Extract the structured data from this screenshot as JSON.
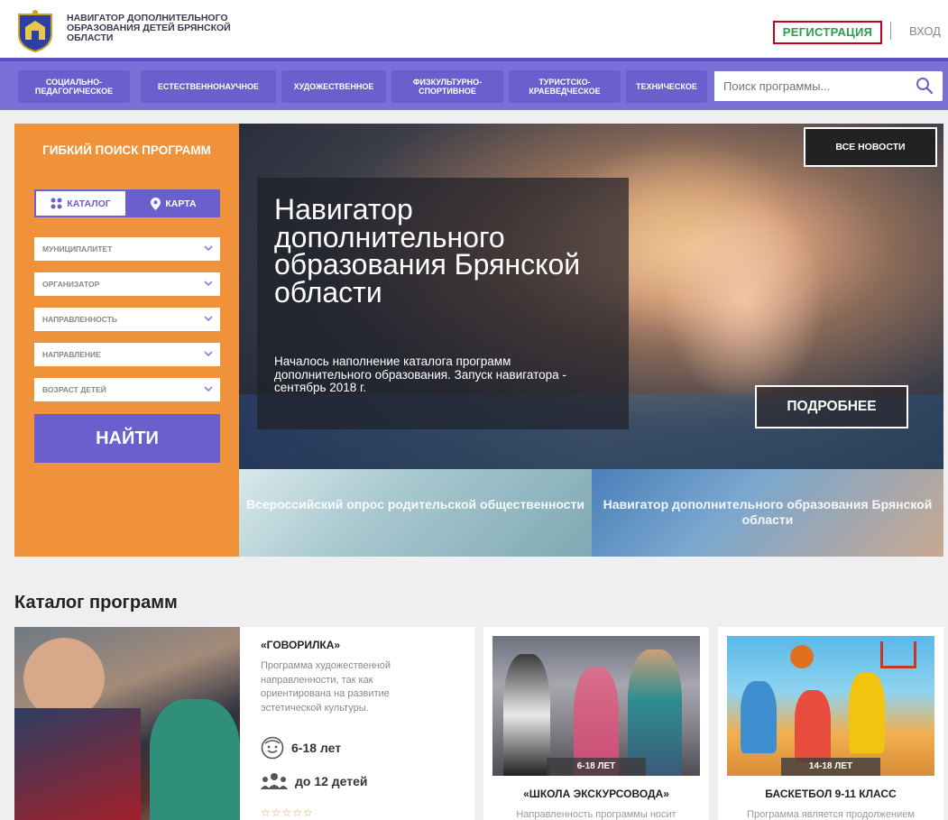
{
  "header": {
    "site_title": "НАВИГАТОР ДОПОЛНИТЕЛЬНОГО ОБРАЗОВАНИЯ ДЕТЕЙ БРЯНСКОЙ ОБЛАСТИ",
    "register": "РЕГИСТРАЦИЯ",
    "login": "ВХОД"
  },
  "nav": {
    "items": [
      {
        "label": "СОЦИАЛЬНО-ПЕДАГОГИЧЕСКОЕ"
      },
      {
        "label": "ЕСТЕСТВЕННОНАУЧНОЕ"
      },
      {
        "label": "ХУДОЖЕСТВЕННОЕ"
      },
      {
        "label": "ФИЗКУЛЬТУРНО-СПОРТИВНОЕ"
      },
      {
        "label": "ТУРИСТСКО-КРАЕВЕДЧЕСКОЕ"
      },
      {
        "label": "ТЕХНИЧЕСКОЕ"
      }
    ],
    "search_placeholder": "Поиск программы..."
  },
  "filter": {
    "title": "ГИБКИЙ ПОИСК ПРОГРАММ",
    "tab_catalog": "КАТАЛОГ",
    "tab_map": "КАРТА",
    "selects": [
      {
        "label": "МУНИЦИПАЛИТЕТ"
      },
      {
        "label": "ОРГАНИЗАТОР"
      },
      {
        "label": "НАПРАВЛЕННОСТЬ"
      },
      {
        "label": "НАПРАВЛЕНИЕ"
      },
      {
        "label": "ВОЗРАСТ ДЕТЕЙ"
      }
    ],
    "find": "НАЙТИ"
  },
  "hero": {
    "all_news": "ВСЕ НОВОСТИ",
    "title": "Навигатор дополнительного образования Брянской области",
    "text": "Началось наполнение каталога программ дополнительного образования. Запуск навигатора - сентябрь 2018 г.",
    "more": "ПОДРОБНЕЕ"
  },
  "subbanners": [
    {
      "text": "Всероссийский опрос родительской общественности"
    },
    {
      "text": "Навигатор дополнительного образования Брянской области"
    }
  ],
  "catalog": {
    "title": "Каталог программ",
    "featured": {
      "name": "«ГОВОРИЛКА»",
      "description": "Программа художественной направленности, так как ориентирована на развитие эстетической культуры.",
      "age": "6-18 лет",
      "group": "до 12 детей",
      "stars": "☆☆☆☆☆"
    },
    "cards": [
      {
        "age": "6-18 ЛЕТ",
        "name": "«ШКОЛА ЭКСКУРСОВОДА»",
        "desc": "Направленность программы носит"
      },
      {
        "age": "14-18 ЛЕТ",
        "name": "БАСКЕТБОЛ 9-11 КЛАСС",
        "desc": "Программа является продолжением"
      }
    ]
  },
  "colors": {
    "accent_purple": "#6a5fcc",
    "filter_orange": "#f0923a",
    "register_border": "#c0001a",
    "register_text": "#2aa04a"
  }
}
